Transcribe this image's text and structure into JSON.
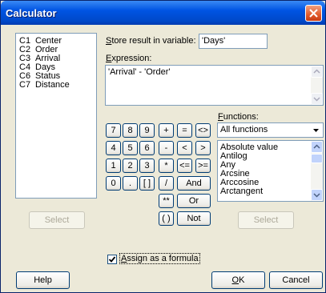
{
  "window": {
    "title": "Calculator"
  },
  "columns": [
    {
      "id": "C1",
      "name": "Center"
    },
    {
      "id": "C2",
      "name": "Order"
    },
    {
      "id": "C3",
      "name": "Arrival"
    },
    {
      "id": "C4",
      "name": "Days"
    },
    {
      "id": "C6",
      "name": "Status"
    },
    {
      "id": "C7",
      "name": "Distance"
    }
  ],
  "store": {
    "label_prefix": "S",
    "label_rest": "tore result in variable:",
    "value": "'Days'"
  },
  "expression": {
    "label_prefix": "E",
    "label_rest": "xpression:",
    "value": "'Arrival' - 'Order'"
  },
  "keypad": [
    {
      "label": "7",
      "name": "key-7"
    },
    {
      "label": "8",
      "name": "key-8"
    },
    {
      "label": "9",
      "name": "key-9"
    },
    {
      "label": "+",
      "name": "key-plus"
    },
    {
      "label": "=",
      "name": "key-equals"
    },
    {
      "label": "<>",
      "name": "key-not-equal"
    },
    {
      "label": "4",
      "name": "key-4"
    },
    {
      "label": "5",
      "name": "key-5"
    },
    {
      "label": "6",
      "name": "key-6"
    },
    {
      "label": "-",
      "name": "key-minus"
    },
    {
      "label": "<",
      "name": "key-less-than"
    },
    {
      "label": ">",
      "name": "key-greater-than"
    },
    {
      "label": "1",
      "name": "key-1"
    },
    {
      "label": "2",
      "name": "key-2"
    },
    {
      "label": "3",
      "name": "key-3"
    },
    {
      "label": "*",
      "name": "key-multiply"
    },
    {
      "label": "<=",
      "name": "key-less-equal"
    },
    {
      "label": ">=",
      "name": "key-greater-equal"
    },
    {
      "label": "0",
      "name": "key-0"
    },
    {
      "label": ".",
      "name": "key-decimal"
    },
    {
      "label": "[ ]",
      "name": "key-brackets"
    },
    {
      "label": "/",
      "name": "key-divide"
    },
    {
      "label": "And",
      "name": "key-and"
    },
    {
      "label": "**",
      "name": "key-power"
    },
    {
      "label": "Or",
      "name": "key-or"
    },
    {
      "label": "( )",
      "name": "key-parentheses"
    },
    {
      "label": "Not",
      "name": "key-not"
    }
  ],
  "functions": {
    "label_prefix": "F",
    "label_rest": "unctions:",
    "category": "All functions",
    "items": [
      "Absolute value",
      "Antilog",
      "Any",
      "Arcsine",
      "Arccosine",
      "Arctangent"
    ]
  },
  "select_left_label": "Select",
  "select_right_label": "Select",
  "assign_formula": {
    "checked": true,
    "label_prefix": "A",
    "label_rest": "ssign as a formula"
  },
  "help_label": "Help",
  "ok_label_prefix": "O",
  "ok_label_rest": "K",
  "cancel_label": "Cancel"
}
